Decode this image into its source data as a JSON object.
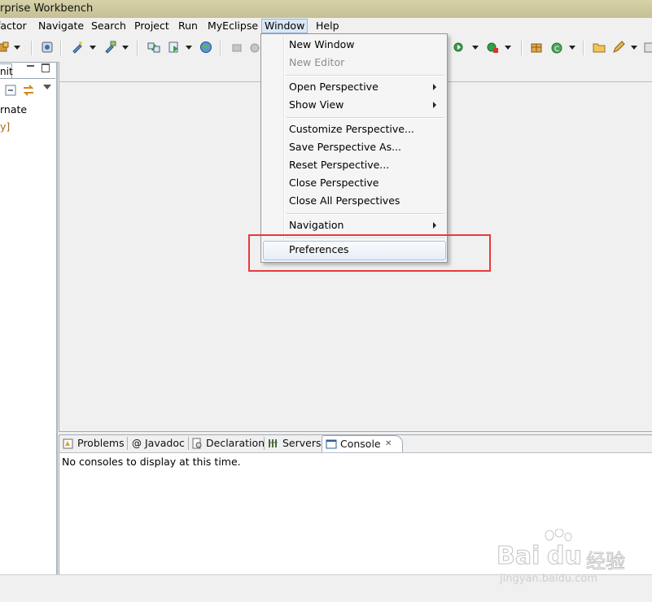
{
  "titlebar": {
    "title": "rprise Workbench"
  },
  "menubar": {
    "items": [
      "factor",
      "Navigate",
      "Search",
      "Project",
      "Run",
      "MyEclipse",
      "Window",
      "Help"
    ]
  },
  "left_panel": {
    "tab_label": "nit",
    "lines": [
      "rnate",
      "y]"
    ]
  },
  "window_menu": {
    "new_window": "New Window",
    "new_editor": "New Editor",
    "open_perspective": "Open Perspective",
    "show_view": "Show View",
    "customize_perspective": "Customize Perspective...",
    "save_perspective_as": "Save Perspective As...",
    "reset_perspective": "Reset Perspective...",
    "close_perspective": "Close Perspective",
    "close_all_perspectives": "Close All Perspectives",
    "navigation": "Navigation",
    "preferences": "Preferences"
  },
  "bottom_tabs": {
    "problems": "Problems",
    "javadoc": "Javadoc",
    "declaration": "Declaration",
    "servers": "Servers",
    "console": "Console",
    "close_glyph": "✕"
  },
  "console": {
    "message": "No consoles to display at this time."
  },
  "watermark": {
    "brand": "Bai",
    "brand2": "du",
    "cn": "经验",
    "url": "jingyan.baidu.com"
  },
  "colors": {
    "annotation_red": "#e8393b",
    "menu_highlight_border": "#a8c3e2",
    "active_menu_bg": "#dbe7f5"
  }
}
